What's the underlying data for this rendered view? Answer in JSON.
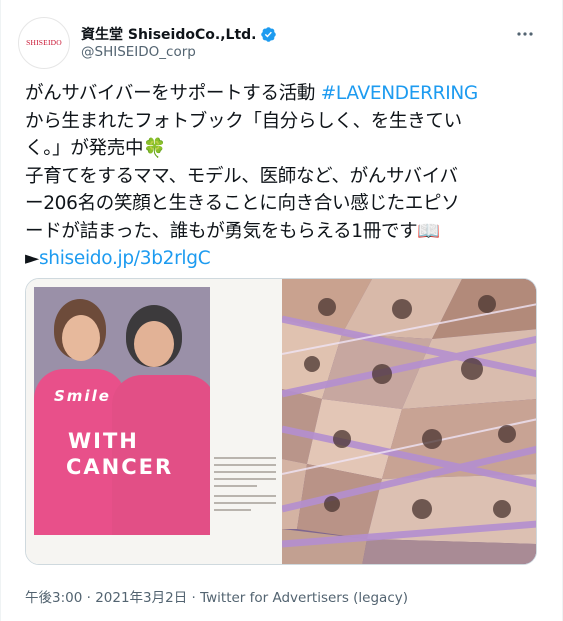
{
  "author": {
    "display_name": "資生堂 ShiseidoCo.,Ltd.",
    "handle": "@SHISEIDO_corp",
    "avatar_text": "SHISEIDO",
    "verified": true
  },
  "tweet": {
    "line1_text": "がんサバイバーをサポートする活動 ",
    "line1_hashtag": "#LAVENDERRING",
    "line2": "から生まれたフォトブック「自分らしく、を生きてい",
    "line3": "く。」が発売中🍀",
    "line4": "子育てをするママ、モデル、医師など、がんサバイバ",
    "line5": "ー206名の笑顔と生きることに向き合い感じたエピソ",
    "line6": "ードが詰まった、誰もが勇気をもらえる1冊です📖",
    "line7_arrow": "►",
    "line7_link": "shiseido.jp/3b2rlgC"
  },
  "media": {
    "shirt_line1": "Smile",
    "shirt_line2": "WITH",
    "shirt_line3": "CANCER"
  },
  "meta": {
    "timestamp": "午後3:00 · 2021年3月2日 · Twitter for Advertisers (legacy)"
  },
  "colors": {
    "accent": "#1d9bf0",
    "verified": "#1d9bf0",
    "brand": "#c8102e",
    "shirt": "#e8508a",
    "lavender": "#a98bbf"
  },
  "icons": {
    "verified": "verified-badge-icon",
    "more": "more-options-icon"
  }
}
